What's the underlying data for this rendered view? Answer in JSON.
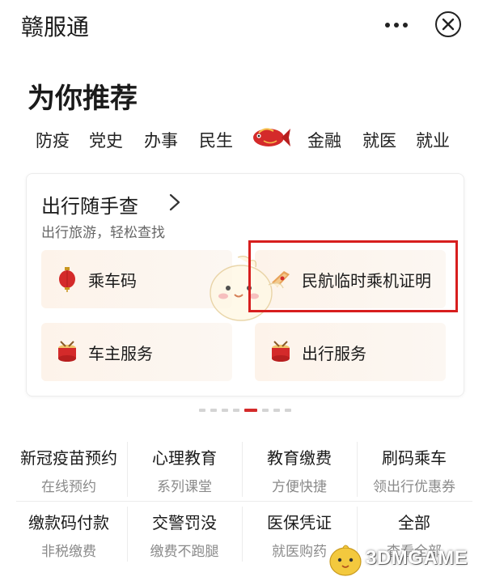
{
  "header": {
    "title": "赣服通",
    "more_icon": "more-dots-icon",
    "close_icon": "close-circle-icon"
  },
  "recommend": {
    "title": "为你推荐",
    "categories": [
      "防疫",
      "党史",
      "办事",
      "民生",
      "金融",
      "就医",
      "就业"
    ],
    "featured_icon": "red-fish-icon"
  },
  "travel_card": {
    "title": "出行随手查",
    "subtitle": "出行旅游，轻松查找",
    "chevron_icon": "chevron-right-icon",
    "tiles": [
      {
        "label": "乘车码",
        "icon": "red-lantern-icon"
      },
      {
        "label": "民航临时乘机证明",
        "icon": "plane-ticket-icon"
      },
      {
        "label": "车主服务",
        "icon": "red-drum-icon"
      },
      {
        "label": "出行服务",
        "icon": "red-drum-icon"
      }
    ],
    "highlight_color": "#d71e1e"
  },
  "carousel": {
    "page_count": 8,
    "active_index": 4
  },
  "services": [
    {
      "title": "新冠疫苗预约",
      "sub": "在线预约"
    },
    {
      "title": "心理教育",
      "sub": "系列课堂"
    },
    {
      "title": "教育缴费",
      "sub": "方便快捷"
    },
    {
      "title": "刷码乘车",
      "sub": "领出行优惠券"
    },
    {
      "title": "缴款码付款",
      "sub": "非税缴费"
    },
    {
      "title": "交警罚没",
      "sub": "缴费不跑腿"
    },
    {
      "title": "医保凭证",
      "sub": "就医购药"
    },
    {
      "title": "全部",
      "sub": "查看全部"
    }
  ],
  "watermark": {
    "text": "3DMGAME"
  },
  "colors": {
    "accent": "#d42a2a",
    "tile_bg": "#fdf3ea"
  }
}
